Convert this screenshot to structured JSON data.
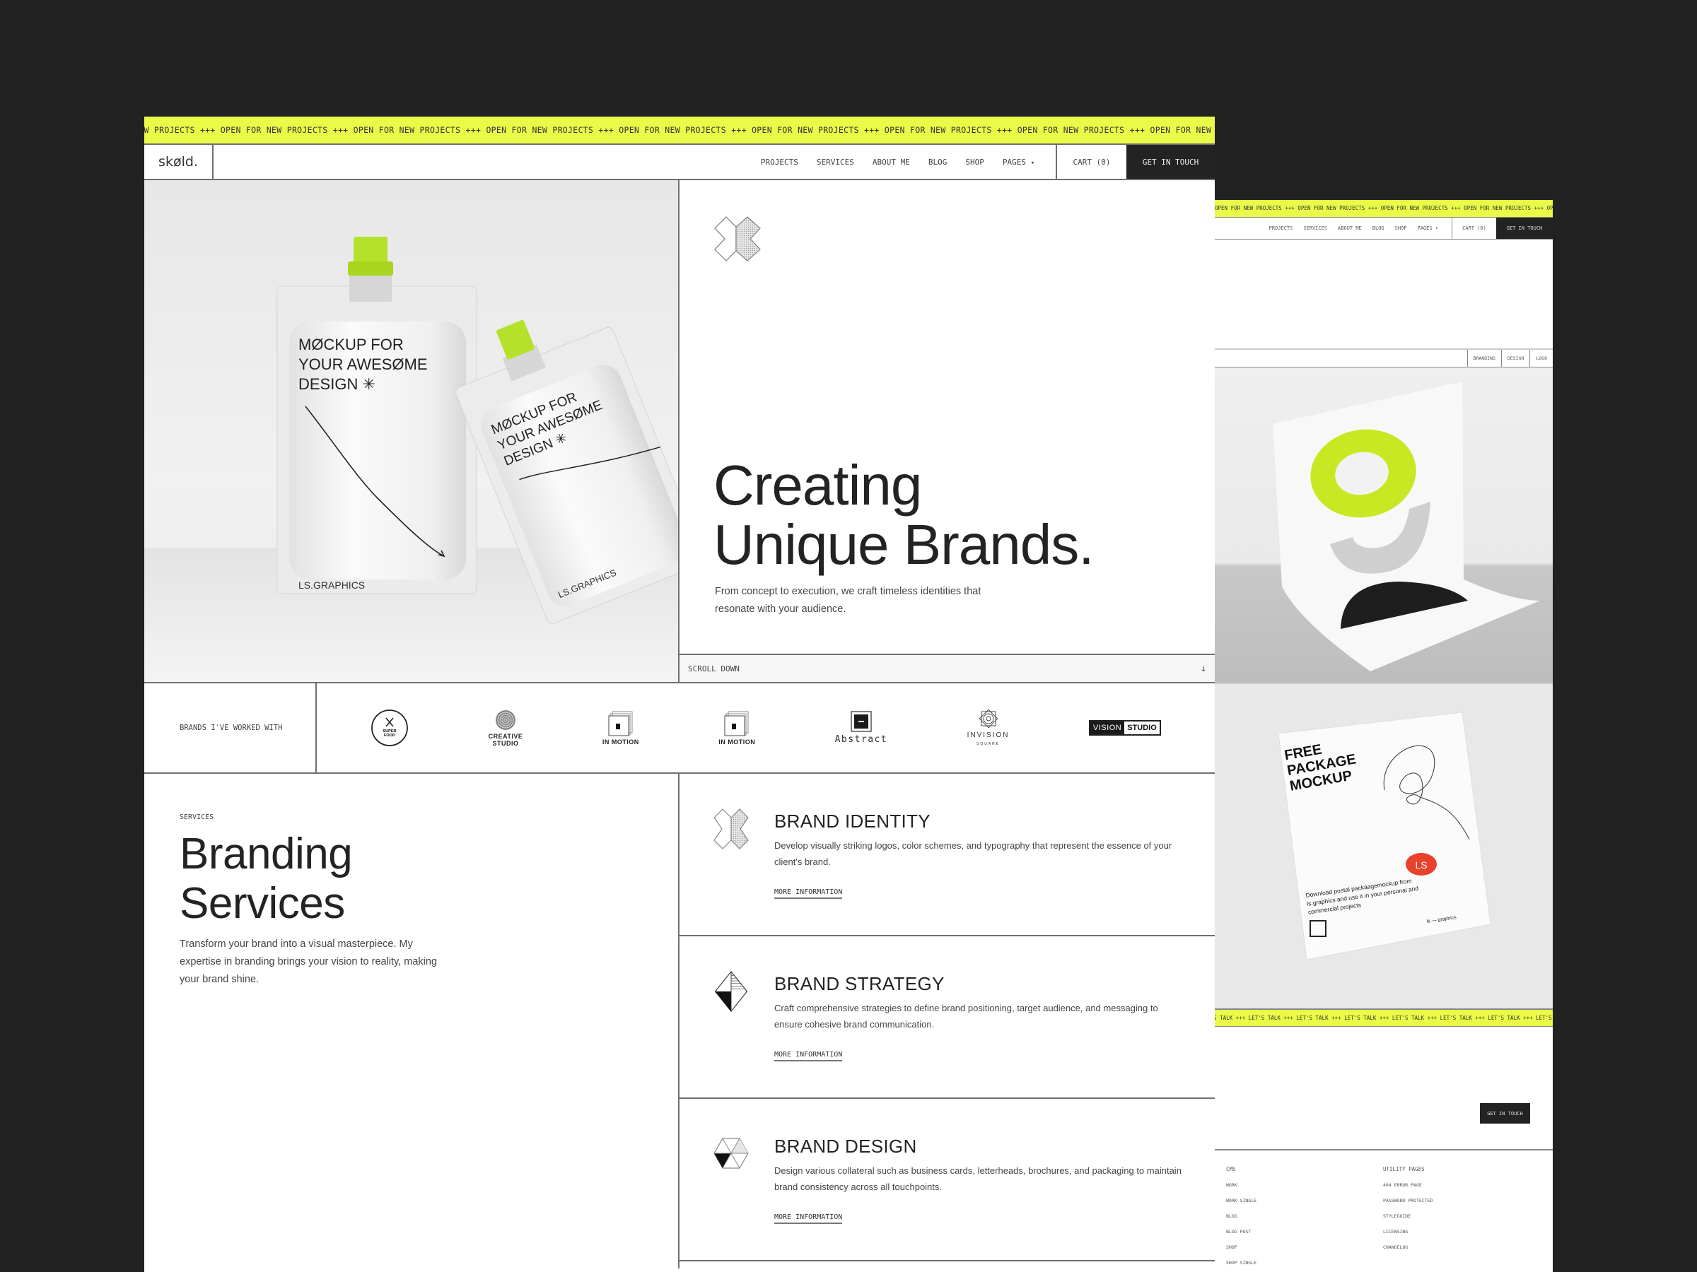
{
  "main": {
    "marquee_text": "OPEN FOR NEW PROJECTS",
    "marquee_sep": "+++",
    "nav": {
      "logo": "skøld.",
      "links": [
        "PROJECTS",
        "SERVICES",
        "ABOUT ME",
        "BLOG",
        "SHOP",
        "PAGES"
      ],
      "pages_caret": "▾",
      "cart": "CART (0)",
      "cta": "GET IN TOUCH"
    },
    "hero": {
      "image_text": {
        "pouch_headline": "MØCKUP FOR YOUR AWESØME DESIGN ✳",
        "pouch_brand": "LS.GRAPHICS"
      },
      "title_line1": "Creating",
      "title_line2": "Unique Brands.",
      "subtitle": "From concept to execution, we craft timeless identities that resonate with your audience.",
      "scroll_label": "SCROLL DOWN",
      "scroll_icon": "↓"
    },
    "brands": {
      "label": "BRANDS I'VE WORKED WITH",
      "items": [
        {
          "name": "SUPER FOOD",
          "line1": "SUPER",
          "line2": "FOOD"
        },
        {
          "name": "CREATIVE STUDIO",
          "line1": "CREATIVE",
          "line2": "STUDIO"
        },
        {
          "name": "IN MOTION",
          "line1": "IN MOTION"
        },
        {
          "name": "IN MOTION",
          "line1": "IN MOTION"
        },
        {
          "name": "Abstract",
          "line1": "Abstract"
        },
        {
          "name": "INVISION SQUARE",
          "line1": "INVISION",
          "line2": "SQUARE"
        },
        {
          "name": "VISION STUDIO",
          "line1": "VISION",
          "line2": "STUDIO"
        }
      ]
    },
    "services": {
      "eyebrow": "SERVICES",
      "title_line1": "Branding",
      "title_line2": "Services",
      "description": "Transform your brand into a visual masterpiece. My expertise in branding brings your vision to reality, making your brand shine.",
      "items": [
        {
          "title": "BRAND IDENTITY",
          "description": "Develop visually striking logos, color schemes, and typography that represent the essence of your client's brand.",
          "link": "MORE INFORMATION"
        },
        {
          "title": "BRAND STRATEGY",
          "description": "Craft comprehensive strategies to define brand positioning, target audience, and messaging to ensure cohesive brand communication.",
          "link": "MORE INFORMATION"
        },
        {
          "title": "BRAND DESIGN",
          "description": "Design various collateral such as business cards, letterheads, brochures, and packaging to maintain brand consistency across all touchpoints.",
          "link": "MORE INFORMATION"
        }
      ]
    }
  },
  "second": {
    "marquee_text": "OPEN FOR NEW PROJECTS",
    "marquee_sep": "+++",
    "nav": {
      "links": [
        "PROJECTS",
        "SERVICES",
        "ABOUT ME",
        "BLOG",
        "SHOP",
        "PAGES"
      ],
      "pages_caret": "▾",
      "cart": "CART (0)",
      "cta": "GET IN TOUCH"
    },
    "tags": [
      "BRANDING",
      "DESIGN",
      "LOGO"
    ],
    "package_text": {
      "headline": "FREE PACKAGE MOCKUP",
      "body": "Download postal packaagemockup from ls.graphics and use it in your personal and commercial projects",
      "badge": "LS",
      "brand": "ls — graphics"
    },
    "talk_marquee_text": "LET'S TALK",
    "talk_cta": "GET IN TOUCH",
    "footer": {
      "columns": [
        {
          "heading": "CMS",
          "items": [
            "WORK",
            "WORK SINGLE",
            "BLOG",
            "BLOG POST",
            "SHOP",
            "SHOP SINGLE"
          ]
        },
        {
          "heading": "UTILITY PAGES",
          "items": [
            "404 ERROR PAGE",
            "PASSWORD PROTECTED",
            "STYLEGUIDE",
            "LICENSING",
            "CHANGELOG"
          ]
        }
      ]
    }
  },
  "colors": {
    "background": "#222222",
    "accent": "#e9fb47",
    "text": "#232323",
    "cta_bg": "#232323",
    "badge_red": "#e8412c"
  }
}
